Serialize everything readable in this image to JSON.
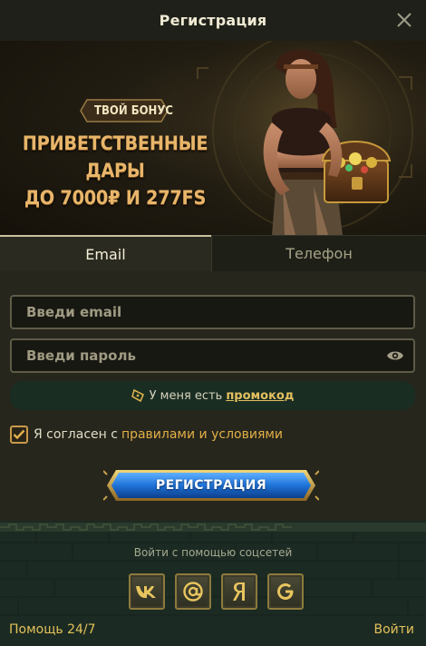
{
  "header": {
    "title": "Регистрация"
  },
  "banner": {
    "badge": "ТВОЙ БОНУС",
    "headline_line1": "ПРИВЕТСТВЕННЫЕ ДАРЫ",
    "headline_line2": "ДО 7000₽ И 277FS"
  },
  "tabs": [
    {
      "label": "Email",
      "active": true
    },
    {
      "label": "Телефон",
      "active": false
    }
  ],
  "form": {
    "email_placeholder": "Введи email",
    "password_placeholder": "Введи пароль",
    "promo_text": "У меня есть",
    "promo_link": "промокод",
    "agree_text": "Я согласен с",
    "agree_link": "правилами и условиями",
    "agree_checked": true,
    "submit_label": "РЕГИСТРАЦИЯ"
  },
  "social": {
    "title": "Войти с помощью соцсетей",
    "providers": [
      {
        "name": "vk-icon",
        "glyph": "vk"
      },
      {
        "name": "mail-icon",
        "glyph": "@"
      },
      {
        "name": "yandex-icon",
        "glyph": "Я"
      },
      {
        "name": "google-icon",
        "glyph": "G"
      }
    ]
  },
  "footer": {
    "help": "Помощь 24/7",
    "login": "Войти"
  },
  "colors": {
    "accent": "#e2c15a",
    "button_blue": "#1f73d8",
    "tab_active": "#2a2a20",
    "promo_bg": "#1a2d23"
  }
}
